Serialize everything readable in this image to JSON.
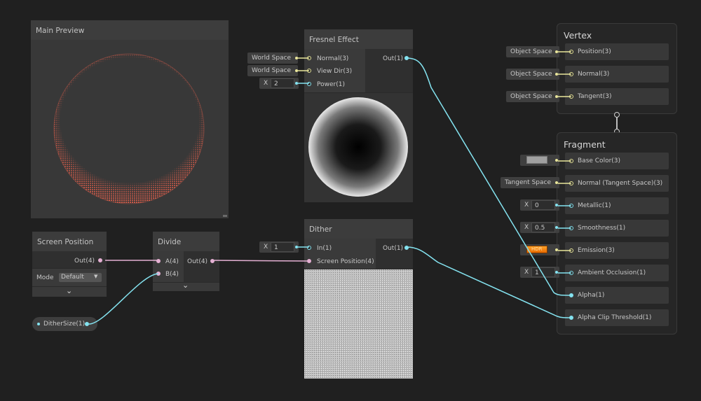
{
  "main_preview": {
    "title": "Main Preview"
  },
  "fresnel": {
    "title": "Fresnel Effect",
    "inputs": [
      {
        "label": "Normal(3)",
        "chip": "World Space"
      },
      {
        "label": "View Dir(3)",
        "chip": "World Space"
      },
      {
        "label": "Power(1)",
        "x": "X",
        "value": "2"
      }
    ],
    "output": "Out(1)"
  },
  "dither": {
    "title": "Dither",
    "inputs": [
      {
        "label": "In(1)",
        "x": "X",
        "value": "1"
      },
      {
        "label": "Screen Position(4)"
      }
    ],
    "output": "Out(1)"
  },
  "screen_position": {
    "title": "Screen Position",
    "output": "Out(4)",
    "mode_label": "Mode",
    "mode_value": "Default"
  },
  "divide": {
    "title": "Divide",
    "inputs": [
      "A(4)",
      "B(4)"
    ],
    "output": "Out(4)"
  },
  "property": {
    "label": "DitherSize(1)"
  },
  "vertex": {
    "title": "Vertex",
    "blocks": [
      {
        "label": "Position(3)",
        "chip": "Object Space"
      },
      {
        "label": "Normal(3)",
        "chip": "Object Space"
      },
      {
        "label": "Tangent(3)",
        "chip": "Object Space"
      }
    ]
  },
  "fragment": {
    "title": "Fragment",
    "blocks": [
      {
        "label": "Base Color(3)",
        "swatch": "#a0a0a0"
      },
      {
        "label": "Normal (Tangent Space)(3)",
        "chip": "Tangent Space"
      },
      {
        "label": "Metallic(1)",
        "x": "X",
        "value": "0"
      },
      {
        "label": "Smoothness(1)",
        "x": "X",
        "value": "0.5"
      },
      {
        "label": "Emission(3)",
        "hdr": "HDR"
      },
      {
        "label": "Ambient Occlusion(1)",
        "x": "X",
        "value": "1"
      },
      {
        "label": "Alpha(1)"
      },
      {
        "label": "Alpha Clip Threshold(1)"
      }
    ]
  },
  "colors": {
    "vector3": "#e8e59a",
    "vector1": "#84e3f0",
    "vector4": "#e4b0d3",
    "preview_ring": "#e8614d"
  }
}
